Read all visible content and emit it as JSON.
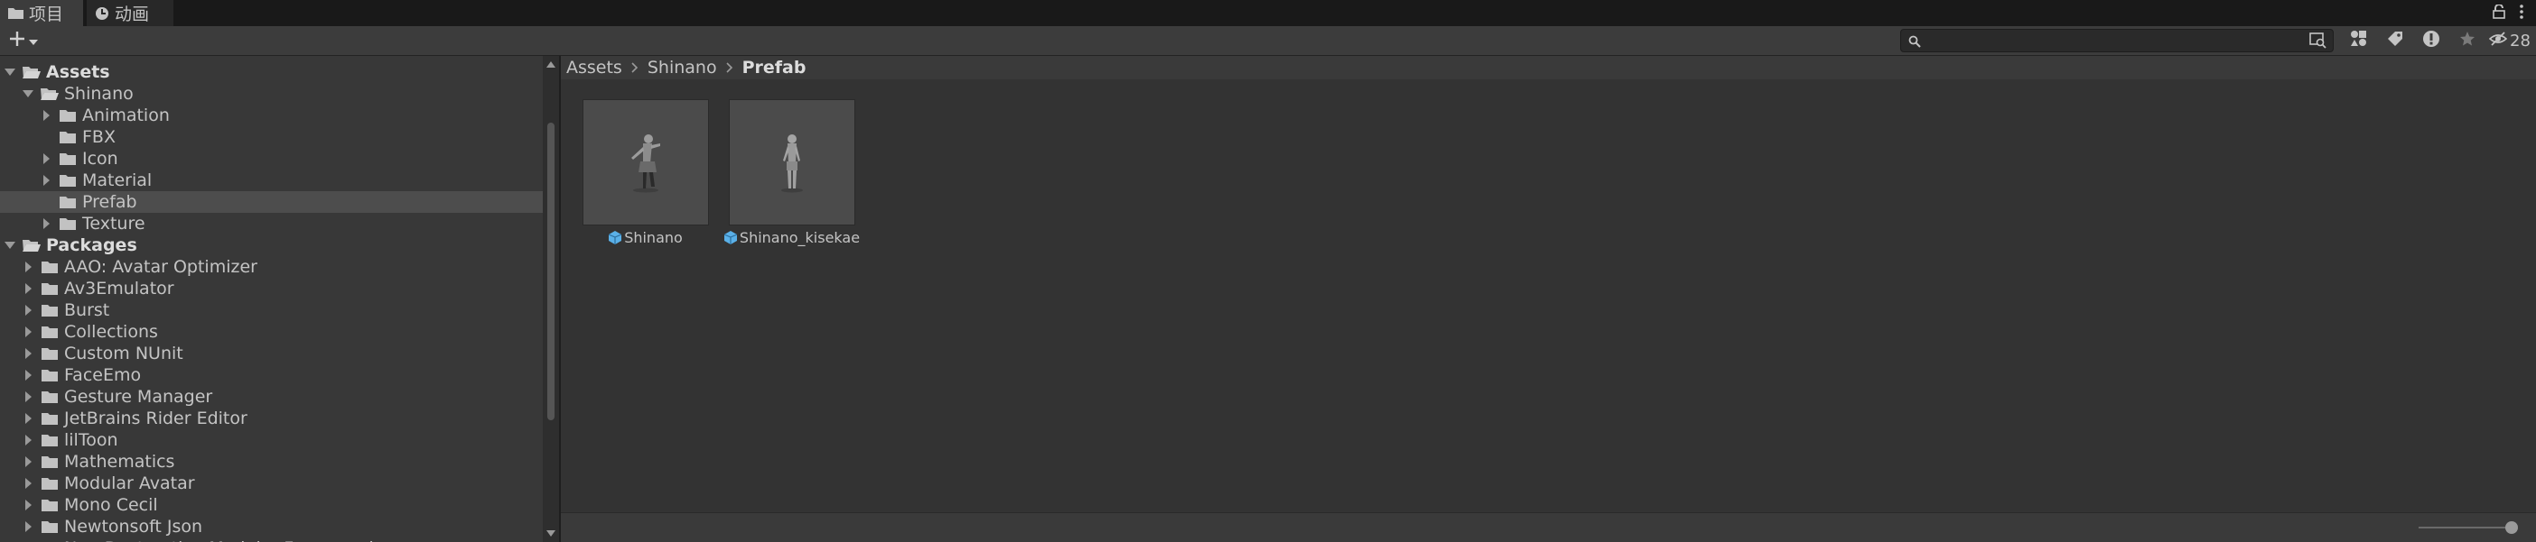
{
  "tabs": {
    "project": {
      "label": "项目",
      "icon": "folder-icon"
    },
    "animation": {
      "label": "动画",
      "icon": "clock-icon"
    }
  },
  "toolbar": {
    "add_icon": "plus-icon",
    "search": {
      "value": "",
      "placeholder": ""
    },
    "hidden_packages_count": "28"
  },
  "tree": [
    {
      "label": "Assets",
      "depth": 0,
      "expanded": true,
      "bold": true
    },
    {
      "label": "Shinano",
      "depth": 1,
      "expanded": true
    },
    {
      "label": "Animation",
      "depth": 2,
      "expanded": false
    },
    {
      "label": "FBX",
      "depth": 2,
      "leaf": true
    },
    {
      "label": "Icon",
      "depth": 2,
      "expanded": false
    },
    {
      "label": "Material",
      "depth": 2,
      "expanded": false
    },
    {
      "label": "Prefab",
      "depth": 2,
      "leaf": true,
      "selected": true
    },
    {
      "label": "Texture",
      "depth": 2,
      "expanded": false
    },
    {
      "label": "Packages",
      "depth": 0,
      "expanded": true,
      "bold": true
    },
    {
      "label": "AAO: Avatar Optimizer",
      "depth": 1,
      "expanded": false
    },
    {
      "label": "Av3Emulator",
      "depth": 1,
      "expanded": false
    },
    {
      "label": "Burst",
      "depth": 1,
      "expanded": false
    },
    {
      "label": "Collections",
      "depth": 1,
      "expanded": false
    },
    {
      "label": "Custom NUnit",
      "depth": 1,
      "expanded": false
    },
    {
      "label": "FaceEmo",
      "depth": 1,
      "expanded": false
    },
    {
      "label": "Gesture Manager",
      "depth": 1,
      "expanded": false
    },
    {
      "label": "JetBrains Rider Editor",
      "depth": 1,
      "expanded": false
    },
    {
      "label": "lilToon",
      "depth": 1,
      "expanded": false
    },
    {
      "label": "Mathematics",
      "depth": 1,
      "expanded": false
    },
    {
      "label": "Modular Avatar",
      "depth": 1,
      "expanded": false
    },
    {
      "label": "Mono Cecil",
      "depth": 1,
      "expanded": false
    },
    {
      "label": "Newtonsoft Json",
      "depth": 1,
      "expanded": false
    },
    {
      "label": "Non-Destructive Modular Framework",
      "depth": 1,
      "expanded": false
    }
  ],
  "breadcrumb": [
    "Assets",
    "Shinano",
    "Prefab"
  ],
  "assets": [
    {
      "name": "Shinano",
      "type_icon": "prefab-icon"
    },
    {
      "name": "Shinano_kisekae",
      "type_icon": "prefab-icon"
    }
  ],
  "colors": {
    "panel": "#383838",
    "content": "#333333",
    "selected_row": "#4d4d4d",
    "prefab_blue": "#5ab0e8",
    "folder": "#c2c2c2"
  }
}
